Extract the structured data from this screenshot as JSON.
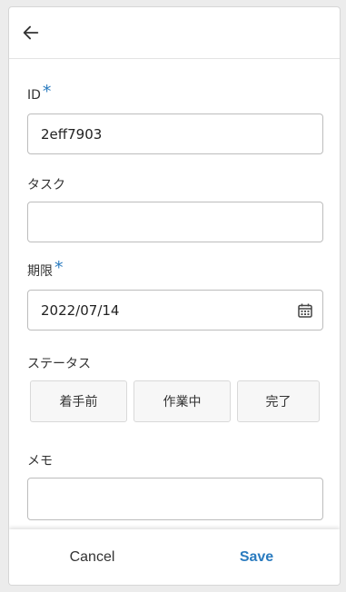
{
  "header": {
    "back_icon": "arrow-left-icon"
  },
  "form": {
    "id": {
      "label": "ID",
      "required": "*",
      "value": "2eff7903"
    },
    "task": {
      "label": "タスク",
      "value": ""
    },
    "due": {
      "label": "期限",
      "required": "*",
      "value": "2022/07/14",
      "icon": "calendar-icon"
    },
    "status": {
      "label": "ステータス",
      "options": [
        "着手前",
        "作業中",
        "完了"
      ]
    },
    "memo": {
      "label": "メモ",
      "value": ""
    }
  },
  "footer": {
    "cancel_label": "Cancel",
    "save_label": "Save"
  },
  "colors": {
    "accent": "#2a7bbf",
    "border": "#bdbdbd"
  }
}
